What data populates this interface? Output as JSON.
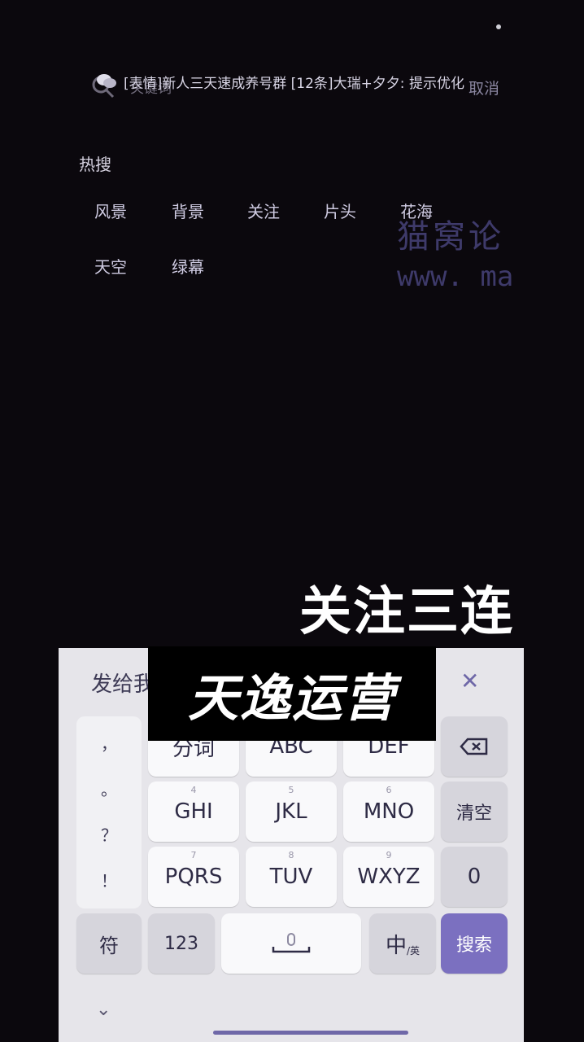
{
  "notification": {
    "text": "[表情]新人三天速成养号群  [12条]大瑞+夕夕: 提示优化"
  },
  "search": {
    "placeholder": "关键词",
    "cancel": "取消"
  },
  "hot": {
    "title": "热搜",
    "tags": [
      "风景",
      "背景",
      "关注",
      "片头",
      "花海",
      "天空",
      "绿幕"
    ]
  },
  "watermark": {
    "line1": "猫窝论",
    "line2": "www. ma"
  },
  "overlays": {
    "follow": "关注三连",
    "brand": "天逸运营"
  },
  "keyboard": {
    "send_label": "发给我",
    "punctuation": [
      "，",
      "。",
      "？",
      "！"
    ],
    "rows": [
      [
        {
          "label": "分词",
          "num": ""
        },
        {
          "label": "ABC",
          "num": ""
        },
        {
          "label": "DEF",
          "num": ""
        }
      ],
      [
        {
          "label": "GHI",
          "num": "4"
        },
        {
          "label": "JKL",
          "num": "5"
        },
        {
          "label": "MNO",
          "num": "6"
        }
      ],
      [
        {
          "label": "PQRS",
          "num": "7"
        },
        {
          "label": "TUV",
          "num": "8"
        },
        {
          "label": "WXYZ",
          "num": "9"
        }
      ]
    ],
    "clear_label": "清空",
    "zero_label": "0",
    "symbol_label": "符",
    "num_label": "123",
    "lang_label": "中",
    "lang_sub": "/英",
    "search_label": "搜索"
  },
  "colors": {
    "accent": "#7b70c0",
    "background": "#0b080d",
    "keyboard": "#e6e5ea"
  }
}
